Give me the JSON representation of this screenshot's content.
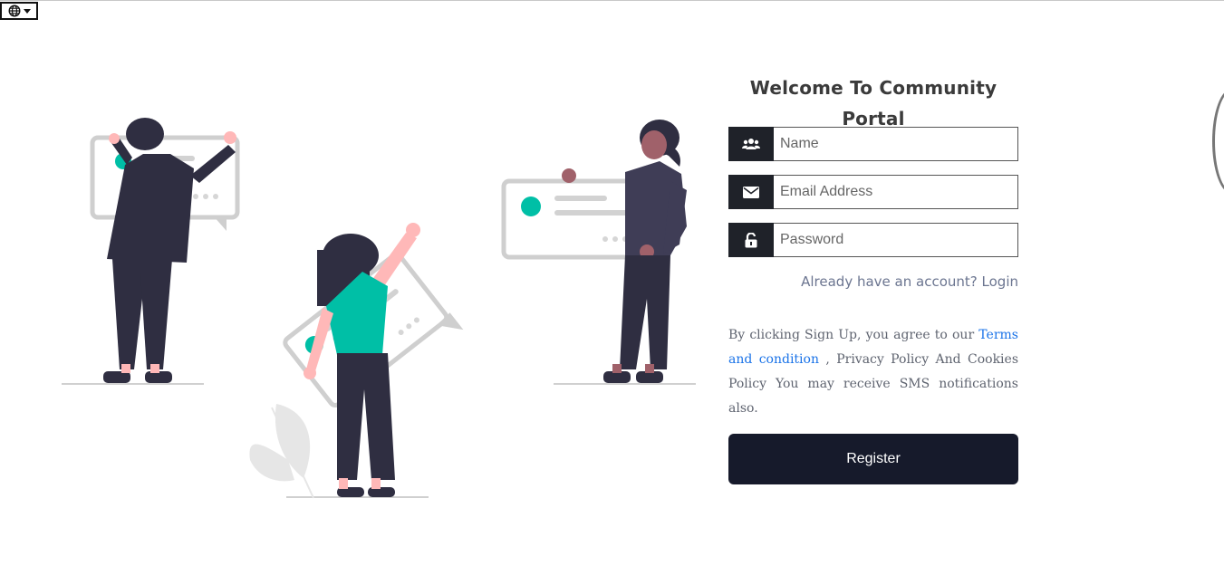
{
  "header": {
    "language_button_icon": "globe-icon"
  },
  "form": {
    "title": "Welcome To Community Portal",
    "name_placeholder": "Name",
    "name_icon": "users-icon",
    "email_placeholder": "Email Address",
    "email_icon": "envelope-icon",
    "password_placeholder": "Password",
    "password_icon": "unlock-icon",
    "login_prompt": "Already have an account?",
    "login_link": "Login",
    "terms_prefix": "By clicking Sign Up, you agree to our",
    "terms_link": "Terms and condition",
    "terms_suffix": ", Privacy Policy And Cookies Policy You may receive SMS notifications also.",
    "register_button": "Register"
  },
  "colors": {
    "dark": "#1f2229",
    "button": "#161a2b",
    "accent": "#00bfa6",
    "link": "#1a73e8"
  }
}
